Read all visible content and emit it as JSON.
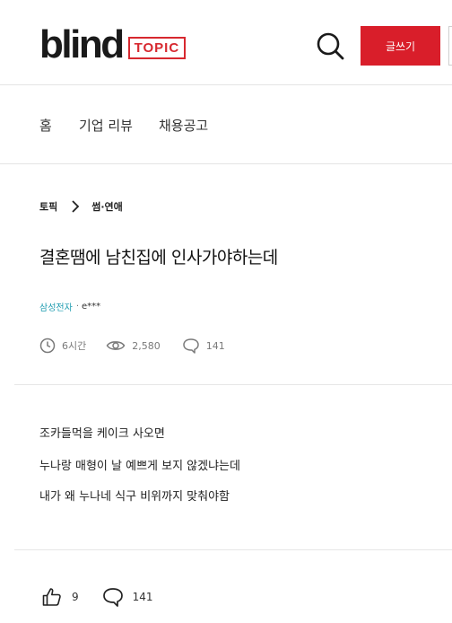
{
  "header": {
    "logo_text": "blind",
    "logo_badge": "TOPIC",
    "write_label": "글쓰기",
    "brand_color": "#d91e2a"
  },
  "nav": {
    "items": [
      {
        "label": "홈"
      },
      {
        "label": "기업 리뷰"
      },
      {
        "label": "채용공고"
      }
    ]
  },
  "post": {
    "breadcrumb": {
      "root": "토픽",
      "category": "썸·연애"
    },
    "title": "결혼땜에 남친집에 인사가야하는데",
    "author_company": "삼성전자",
    "author_separator": "·",
    "author_name": "e***",
    "time_ago": "6시간",
    "views": "2,580",
    "comments": "141",
    "body": [
      "조카들먹을 케이크 사오면",
      "누나랑 매형이 날 예쁘게 보지 않겠냐는데",
      "내가 왜 누나네 식구 비위까지 맞춰야함"
    ]
  },
  "actions": {
    "likes": "9",
    "comments": "141"
  },
  "icons": [
    "search-icon",
    "chevron-right-icon",
    "clock-icon",
    "eye-icon",
    "comment-icon",
    "thumbs-up-icon"
  ]
}
